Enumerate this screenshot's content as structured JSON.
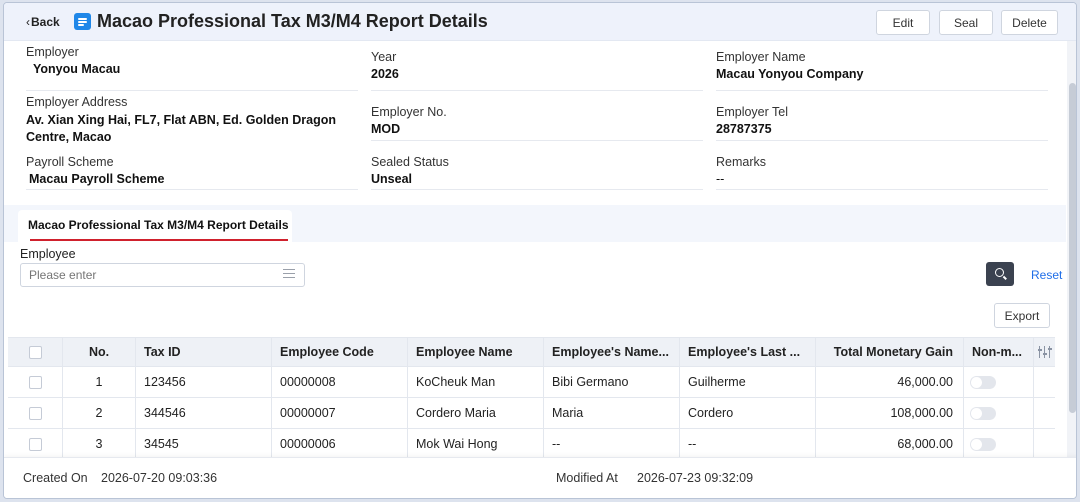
{
  "header": {
    "back_label": "Back",
    "title": "Macao Professional Tax M3/M4 Report Details",
    "edit_label": "Edit",
    "seal_label": "Seal",
    "delete_label": "Delete"
  },
  "info": {
    "employer_label": "Employer",
    "employer_value": "Yonyou Macau",
    "year_label": "Year",
    "year_value": "2026",
    "employer_name_label": "Employer Name",
    "employer_name_value": "Macau Yonyou Company",
    "employer_address_label": "Employer Address",
    "employer_address_value": "Av. Xian Xing Hai, FL7, Flat ABN, Ed. Golden Dragon Centre, Macao",
    "employer_no_label": "Employer No.",
    "employer_no_value": "MOD",
    "employer_tel_label": "Employer Tel",
    "employer_tel_value": "28787375",
    "payroll_scheme_label": "Payroll Scheme",
    "payroll_scheme_value": "Macau Payroll Scheme",
    "sealed_status_label": "Sealed Status",
    "sealed_status_value": "Unseal",
    "remarks_label": "Remarks",
    "remarks_value": "--"
  },
  "tab": {
    "label": "Macao Professional Tax M3/M4 Report Details",
    "accent_color": "#d0212d"
  },
  "filter": {
    "employee_label": "Employee",
    "employee_placeholder": "Please enter",
    "reset_label": "Reset",
    "export_label": "Export"
  },
  "table": {
    "headers": [
      "No.",
      "Tax ID",
      "Employee Code",
      "Employee Name",
      "Employee's Name...",
      "Employee's Last ...",
      "Total Monetary Gain",
      "Non-m..."
    ],
    "rows": [
      {
        "no": "1",
        "tax_id": "123456",
        "code": "00000008",
        "name": "KoCheuk Man",
        "first": "Bibi Germano",
        "last": "Guilherme",
        "total": "46,000.00"
      },
      {
        "no": "2",
        "tax_id": "344546",
        "code": "00000007",
        "name": "Cordero Maria",
        "first": "Maria",
        "last": "Cordero",
        "total": "108,000.00"
      },
      {
        "no": "3",
        "tax_id": "34545",
        "code": "00000006",
        "name": "Mok Wai Hong",
        "first": "--",
        "last": "--",
        "total": "68,000.00"
      }
    ]
  },
  "footer": {
    "created_label": "Created On",
    "created_value": "2026-07-20 09:03:36",
    "modified_label": "Modified At",
    "modified_value": "2026-07-23 09:32:09"
  },
  "colors": {
    "primary_blue": "#1f87e8",
    "link_blue": "#1f6ee8",
    "header_bg": "#eef2fb",
    "search_button": "#3b4250"
  },
  "icons": [
    "chevron-left-icon",
    "report-icon",
    "list-icon",
    "search-icon",
    "column-settings-icon"
  ]
}
